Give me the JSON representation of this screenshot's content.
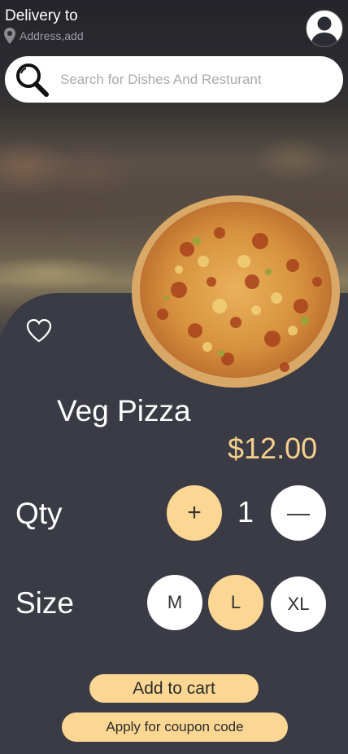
{
  "header": {
    "title": "Delivery to",
    "address": "Address,add"
  },
  "search": {
    "placeholder": "Search for Dishes And Resturant"
  },
  "product": {
    "name": "Veg Pizza",
    "price": "$12.00"
  },
  "quantity": {
    "label": "Qty",
    "increment_label": "+",
    "value": "1",
    "decrement_label": "—"
  },
  "size": {
    "label": "Size",
    "options": [
      "M",
      "L",
      "XL"
    ],
    "selected": "L"
  },
  "actions": {
    "add_to_cart": "Add to cart",
    "coupon": "Apply for coupon code"
  },
  "colors": {
    "accent": "#fcd793",
    "price": "#f5d08c",
    "card_background": "#3b3b45"
  },
  "icons": {
    "location": "map-pin-icon",
    "profile": "user-avatar-icon",
    "search": "magnifier-icon",
    "favorite": "heart-outline-icon"
  }
}
